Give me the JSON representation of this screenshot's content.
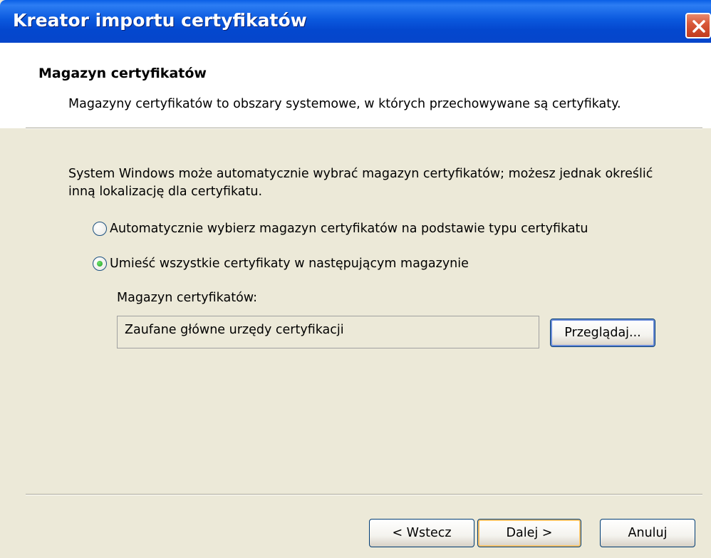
{
  "window": {
    "title": "Kreator importu certyfikatów"
  },
  "header": {
    "title": "Magazyn certyfikatów",
    "subtitle": "Magazyny certyfikatów to obszary systemowe, w których przechowywane są certyfikaty."
  },
  "body": {
    "intro": "System Windows może automatycznie wybrać magazyn certyfikatów; możesz jednak określić inną lokalizację dla certyfikatu.",
    "options": [
      {
        "label": "Automatycznie wybierz magazyn certyfikatów na podstawie typu certyfikatu",
        "checked": false
      },
      {
        "label": "Umieść wszystkie certyfikaty w następującym magazynie",
        "checked": true
      }
    ],
    "store_label": "Magazyn certyfikatów:",
    "store_value": "Zaufane główne urzędy certyfikacji",
    "browse_label": "Przeglądaj..."
  },
  "footer": {
    "back_label": "< Wstecz",
    "next_label": "Dalej >",
    "cancel_label": "Anuluj"
  },
  "icons": {
    "close": "close-icon",
    "radio": "radio-button"
  },
  "colors": {
    "titlebar": "#0A59DE",
    "face": "#ECE9D8",
    "close": "#D9593A"
  }
}
